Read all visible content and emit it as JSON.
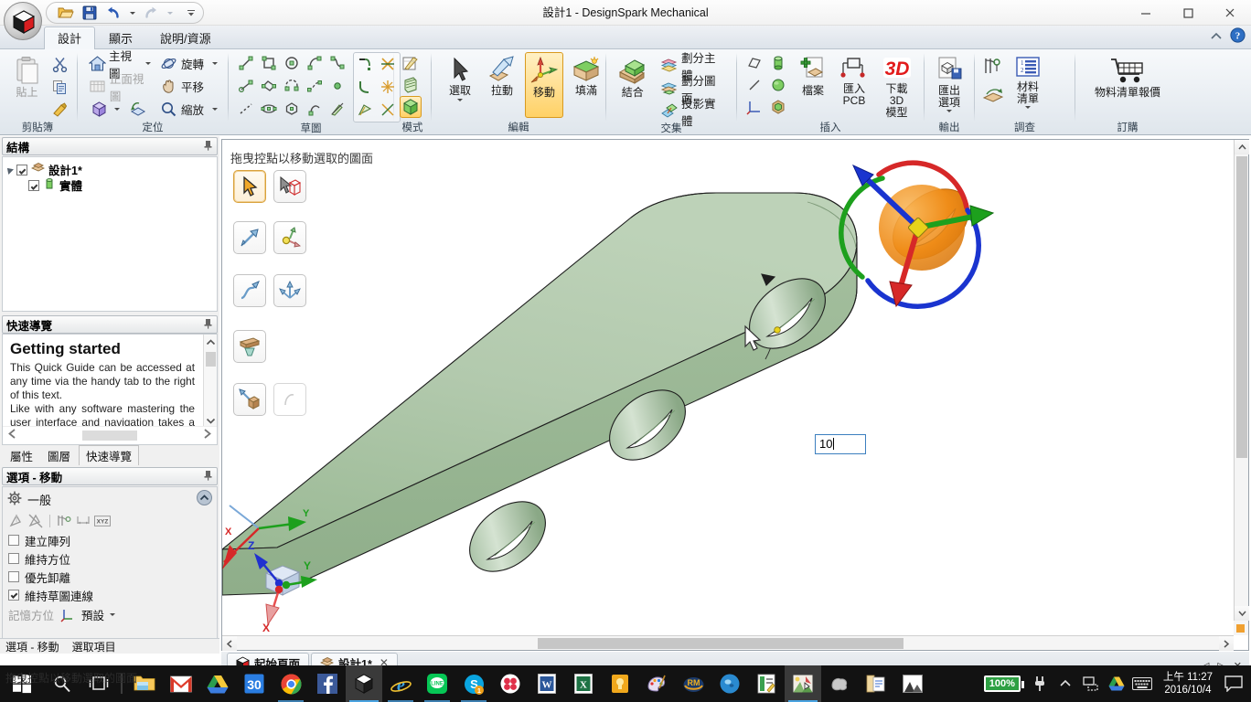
{
  "window": {
    "title": "設計1 - DesignSpark Mechanical",
    "minimize_label": "最小化",
    "maximize_label": "最大化",
    "close_label": "關閉"
  },
  "quick_access": {
    "open_label": "開啟",
    "save_label": "儲存",
    "undo_label": "復原",
    "redo_label": "重做",
    "customize_label": "自訂快速存取工具列"
  },
  "tabs": [
    {
      "label": "設計",
      "active": true
    },
    {
      "label": "顯示",
      "active": false
    },
    {
      "label": "說明/資源",
      "active": false
    }
  ],
  "ribbon": {
    "groups": [
      {
        "name": "clipboard",
        "label": "剪貼簿",
        "big": [
          {
            "label": "貼上",
            "disabled": true,
            "icon": "paste-icon"
          }
        ],
        "small": [
          {
            "label": "",
            "icon": "cut-icon"
          },
          {
            "label": "",
            "icon": "copy-icon"
          },
          {
            "label": "",
            "icon": "format-painter-icon"
          }
        ]
      },
      {
        "name": "orient",
        "label": "定位",
        "items": [
          {
            "label": "主視圖",
            "icon": "home-view-icon",
            "dropdown": true,
            "disabled": false
          },
          {
            "label": "旋轉",
            "icon": "spin-icon",
            "dropdown": true,
            "disabled": false
          },
          {
            "label": "正面視圖",
            "icon": "plan-view-icon",
            "dropdown": false,
            "disabled": true
          },
          {
            "label": "平移",
            "icon": "pan-icon",
            "dropdown": false,
            "disabled": false
          },
          {
            "label": "",
            "icon": "iso-cube-icon",
            "dropdown": true,
            "disabled": false
          },
          {
            "label": "",
            "icon": "previous-view-icon",
            "dropdown": false,
            "disabled": false
          },
          {
            "label": "縮放",
            "icon": "zoom-icon",
            "dropdown": true,
            "disabled": false
          }
        ]
      },
      {
        "name": "sketch",
        "label": "草圖",
        "icons": [
          "line-icon",
          "rectangle-icon",
          "circle-icon",
          "tangent-arc-icon",
          "spline-icon",
          "construction-line-icon",
          "three-point-rectangle-icon",
          "three-point-arc-icon",
          "reference-spline-icon",
          "point-icon",
          "dashed-line-icon",
          "ellipse-icon",
          "polygon-icon",
          "sweep-arc-icon",
          "sketch-edit-icon"
        ],
        "edit_icons": [
          "trim-away-icon",
          "split-icon",
          "corner-icon",
          "explode-icon",
          "offset-icon",
          "project-icon"
        ]
      },
      {
        "name": "mode",
        "label": "模式",
        "icons": [
          "sketch-mode-icon",
          "section-mode-icon",
          "solid-mode-icon"
        ],
        "active_index": 2
      },
      {
        "name": "edit",
        "label": "編輯",
        "items": [
          {
            "label": "選取",
            "icon": "select-icon",
            "dropdown": true,
            "active": false
          },
          {
            "label": "拉動",
            "icon": "pull-icon",
            "dropdown": false,
            "active": false
          },
          {
            "label": "移動",
            "icon": "move-icon",
            "dropdown": false,
            "active": true
          },
          {
            "label": "填滿",
            "icon": "fill-icon",
            "dropdown": false,
            "active": false
          }
        ]
      },
      {
        "name": "intersect",
        "label": "交集",
        "big": [
          {
            "label": "結合",
            "icon": "combine-icon"
          }
        ],
        "small": [
          {
            "label": "劃分主體",
            "icon": "split-body-icon"
          },
          {
            "label": "劃分圖面",
            "icon": "split-face-icon"
          },
          {
            "label": "投影實體",
            "icon": "project-solid-icon"
          }
        ]
      },
      {
        "name": "insert",
        "label": "插入",
        "icons": [
          "plane-icon",
          "cylinder-icon",
          "sphere-icon",
          "axis-icon",
          "origin-icon"
        ],
        "items": [
          {
            "label": "檔案",
            "icon": "insert-file-icon"
          },
          {
            "label": "匯入\nPCB",
            "icon": "import-pcb-icon"
          },
          {
            "label": "下載 3D\n模型",
            "icon": "download-3d-icon"
          }
        ]
      },
      {
        "name": "output",
        "label": "輸出",
        "items": [
          {
            "label": "匯出\n選項",
            "icon": "export-options-icon",
            "dropdown": true
          }
        ]
      },
      {
        "name": "investigate",
        "label": "調查",
        "icons": [
          "measure-icon",
          "mass-properties-icon"
        ],
        "items": [
          {
            "label": "材料\n清單",
            "icon": "bom-icon",
            "dropdown": true
          }
        ]
      },
      {
        "name": "order",
        "label": "訂購",
        "items": [
          {
            "label": "物料清單報價",
            "icon": "cart-icon"
          }
        ]
      }
    ]
  },
  "structure_panel": {
    "title": "結構",
    "pin_label": "釘選",
    "nodes": [
      {
        "label": "設計1*",
        "checked": true,
        "expanded": true,
        "icon": "design-icon",
        "level": 0
      },
      {
        "label": "實體",
        "checked": true,
        "icon": "solid-icon",
        "level": 1
      }
    ]
  },
  "quick_guide": {
    "title": "快速導覽",
    "pin_label": "釘選",
    "heading": "Getting started",
    "paragraphs": [
      "This Quick Guide can be accessed at any time via the handy tab to the right of this text.",
      "Like with any software mastering the user interface and navigation takes a bit of practice. Please select a topic of"
    ],
    "prev_label": "◀",
    "next_label": "▶"
  },
  "panel_tabs": [
    {
      "label": "屬性",
      "active": false
    },
    {
      "label": "圖層",
      "active": false
    },
    {
      "label": "快速導覽",
      "active": true
    }
  ],
  "options_panel": {
    "title": "選項 - 移動",
    "pin_label": "釘選",
    "section_label": "一般",
    "tool_icons": [
      "ruler-direction-icon",
      "anchor-icon",
      "measure-move-icon",
      "dimension-icon",
      "xyz-icon"
    ],
    "checkboxes": [
      {
        "label": "建立陣列",
        "checked": false
      },
      {
        "label": "維持方位",
        "checked": false
      },
      {
        "label": "優先卸離",
        "checked": false
      },
      {
        "label": "維持草圖連線",
        "checked": true
      }
    ],
    "memory_label": "記憶方位",
    "memory_value": "預設"
  },
  "bottom_tabs": [
    {
      "label": "選項 - 移動",
      "active": true
    },
    {
      "label": "選取項目",
      "active": false
    }
  ],
  "canvas": {
    "hint": "拖曳控點以移動選取的圖面",
    "value_box": "10",
    "palette": [
      {
        "row": 0,
        "buttons": [
          {
            "name": "move-handle-select",
            "icon": "arrow-cursor-icon",
            "selected": true
          },
          {
            "name": "move-anchor",
            "icon": "cursor-box-icon",
            "selected": false
          }
        ]
      },
      {
        "row": 1,
        "buttons": [
          {
            "name": "translate-direction",
            "icon": "single-arrow-icon",
            "selected": false
          },
          {
            "name": "move-origin",
            "icon": "axis-origin-icon",
            "selected": false
          }
        ]
      },
      {
        "row": 2,
        "buttons": [
          {
            "name": "sweep-along-path",
            "icon": "curved-arrow-icon",
            "selected": false
          },
          {
            "name": "move-multiple",
            "icon": "three-arrow-icon",
            "selected": false
          }
        ]
      },
      {
        "row": 3,
        "buttons": [
          {
            "name": "ruler-dimension",
            "icon": "ruler-icon",
            "selected": false
          }
        ]
      },
      {
        "row": 4,
        "buttons": [
          {
            "name": "drag-to-snap",
            "icon": "snap-arrow-icon",
            "selected": false
          },
          {
            "name": "ghost-tool",
            "icon": "ghost-icon",
            "selected": false,
            "ghost": true
          }
        ]
      }
    ],
    "axis_labels": {
      "x": "X",
      "y": "Y",
      "z": "Z"
    },
    "colors": {
      "body": "#a9c4a5",
      "body_top": "#b7cdb2",
      "body_side": "#9cb898",
      "handle_ball": "#f08a1c",
      "axis_x": "#e02020",
      "axis_y": "#15a015",
      "axis_z": "#2030cf",
      "handle_center": "#e8d21a"
    }
  },
  "document_tabs": [
    {
      "label": "起始頁面",
      "icon": "home-doc-icon",
      "active": false,
      "closable": false
    },
    {
      "label": "設計1*",
      "icon": "design-doc-icon",
      "active": true,
      "closable": true
    }
  ],
  "status_bar": {
    "text": "拖曳控點以移動選取的圖面"
  },
  "taskbar": {
    "start_label": "開始",
    "search_label": "搜尋",
    "taskview_label": "工作檢視",
    "items": [
      {
        "name": "file-explorer",
        "label": "檔案總管"
      },
      {
        "name": "gmail",
        "label": "Gmail"
      },
      {
        "name": "google-drive",
        "label": "Google 雲端硬碟"
      },
      {
        "name": "calendar",
        "label": "行事曆"
      },
      {
        "name": "chrome",
        "label": "Chrome"
      },
      {
        "name": "facebook",
        "label": "Facebook"
      },
      {
        "name": "designspark",
        "label": "DesignSpark Mechanical"
      },
      {
        "name": "internet-explorer",
        "label": "Internet Explorer"
      },
      {
        "name": "line",
        "label": "LINE"
      },
      {
        "name": "skype",
        "label": "Skype"
      },
      {
        "name": "photoscape",
        "label": "PhotoScape"
      },
      {
        "name": "word",
        "label": "Word"
      },
      {
        "name": "excel",
        "label": "Excel"
      },
      {
        "name": "notes",
        "label": "記事"
      },
      {
        "name": "paint",
        "label": "小畫家"
      },
      {
        "name": "rm-app",
        "label": "RM"
      },
      {
        "name": "blue-app",
        "label": "應用程式"
      },
      {
        "name": "editor-app",
        "label": "編輯器"
      },
      {
        "name": "photo-viewer",
        "label": "相片檢視器"
      },
      {
        "name": "grey-app",
        "label": "應用程式"
      },
      {
        "name": "docs-app",
        "label": "文件"
      },
      {
        "name": "gallery-app",
        "label": "圖庫"
      }
    ],
    "tray": {
      "battery": "100%",
      "power_label": "電源",
      "show_hidden_label": "顯示隱藏的圖示",
      "network_label": "網路",
      "drive_label": "Google 雲端硬碟",
      "keyboard_label": "觸控鍵盤",
      "time": "上午 11:27",
      "date": "2016/10/4",
      "notifications_label": "通知"
    }
  }
}
